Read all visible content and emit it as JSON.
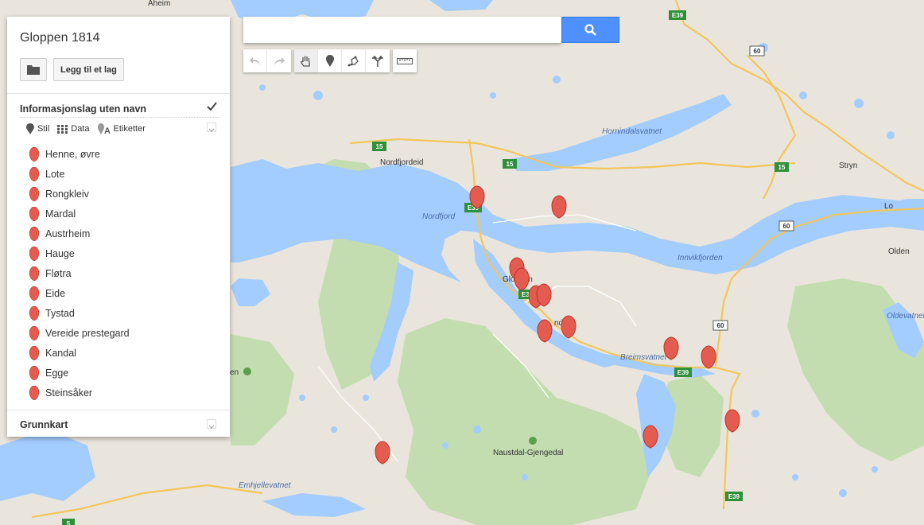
{
  "map_labels": {
    "aheim": "Aheim",
    "nordfjordeid": "Nordfjordeid",
    "nordfjord": "Nordfjord",
    "hornindalsvatnet": "Hornindalsvatnet",
    "stryn": "Stryn",
    "lo": "Lo",
    "olden": "Olden",
    "innvikfjorden": "Innvikfjorden",
    "oldevatnet": "Oldevatnet",
    "gloppen": "Gloppen",
    "sandane_partial": "nd",
    "breimsvatnet": "Breimsvatnet",
    "naustdal_gjengedal": "Naustdal-Gjengedal",
    "emhjellevatnet": "Emhjellevatnet",
    "en_partial": "en"
  },
  "road_shields": {
    "e39_top": "E39",
    "r60_a": "60",
    "r15_a": "15",
    "r15_b": "15",
    "r15_c": "15",
    "e39_nordfjordeid": "E39",
    "r60_b": "60",
    "r60_c": "60",
    "e39_gloppen": "E39",
    "e39_breim": "E39",
    "e39_bottom": "E39",
    "r5": "5"
  },
  "panel": {
    "title": "Gloppen 1814",
    "add_layer_label": "Legg til et lag",
    "layer": {
      "title": "Informasjonslag uten navn",
      "checked": true,
      "options": {
        "style": "Stil",
        "data": "Data",
        "labels": "Etiketter"
      },
      "items": [
        "Henne, øvre",
        "Lote",
        "Rongkleiv",
        "Mardal",
        "Austrheim",
        "Hauge",
        "Fløtra",
        "Eide",
        "Tystad",
        "Vereide prestegard",
        "Kandal",
        "Egge",
        "Steinsåker"
      ]
    },
    "base_map_label": "Grunnkart"
  },
  "search": {
    "value": "",
    "placeholder": ""
  },
  "colors": {
    "water": "#a3ccff",
    "land": "#e9e5dc",
    "forest": "#c3ddb0",
    "road_major": "#f7d36b",
    "marker": "#e35c4f",
    "search_button": "#4d90fe"
  },
  "icons": {
    "folder": "folder-icon",
    "search": "search-icon",
    "undo": "undo-icon",
    "redo": "redo-icon",
    "pan": "hand-icon",
    "marker": "marker-icon",
    "line": "draw-line-icon",
    "directions": "directions-icon",
    "measure": "ruler-icon"
  }
}
